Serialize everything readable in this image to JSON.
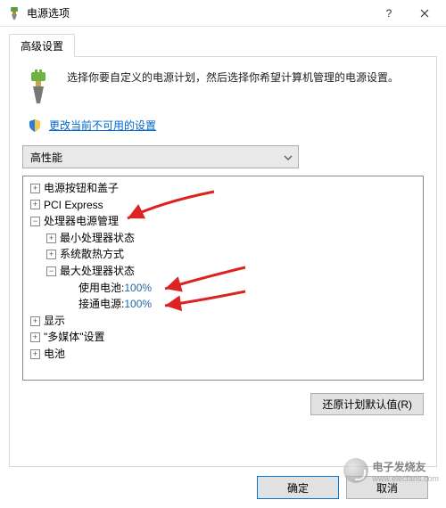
{
  "window": {
    "title": "电源选项"
  },
  "tab": {
    "label": "高级设置"
  },
  "intro": {
    "text": "选择你要自定义的电源计划，然后选择你希望计算机管理的电源设置。"
  },
  "shield": {
    "link": "更改当前不可用的设置"
  },
  "plan": {
    "selected": "高性能"
  },
  "tree": {
    "n0": "电源按钮和盖子",
    "n1": "PCI Express",
    "n2": "处理器电源管理",
    "n2a": "最小处理器状态",
    "n2b": "系统散热方式",
    "n2c": "最大处理器状态",
    "n2c1_k": "使用电池: ",
    "n2c1_v": "100%",
    "n2c2_k": "接通电源: ",
    "n2c2_v": "100%",
    "n3": "显示",
    "n4": "\"多媒体\"设置",
    "n5": "电池"
  },
  "buttons": {
    "restore": "还原计划默认值(R)",
    "ok": "确定",
    "cancel": "取消"
  },
  "watermark": {
    "text": "电子发烧友",
    "url": "www.elecfans.com"
  }
}
